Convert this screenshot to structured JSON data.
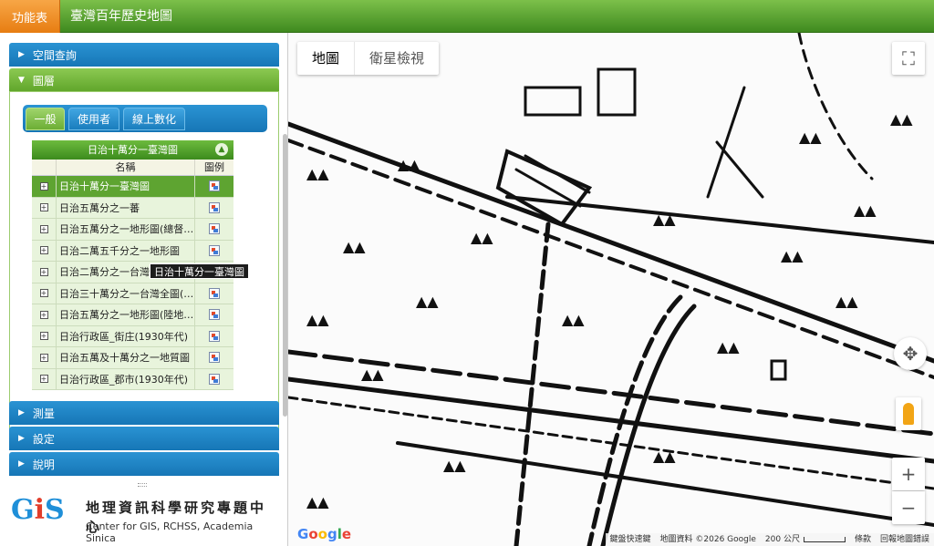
{
  "topbar": {
    "menu_label": "功能表",
    "title": "臺灣百年歷史地圖"
  },
  "sidebar": {
    "sections": {
      "spatial_query": "空間查詢",
      "layers": "圖層",
      "measure": "測量",
      "settings": "設定",
      "help": "說明"
    },
    "tabs": [
      "一般",
      "使用者",
      "線上數化"
    ],
    "active_tab": "一般",
    "layer_table": {
      "title": "日治十萬分一臺灣圖",
      "col_name": "名稱",
      "col_legend": "圖例",
      "rows": [
        "日治十萬分一臺灣圖",
        "日治五萬分之一蕃",
        "日治五萬分之一地形圖(總督…",
        "日治二萬五千分之一地形圖",
        "日治二萬分之一台灣堡圖(大…",
        "日治三十萬分之一台灣全圖(…",
        "日治五萬分之一地形圖(陸地…",
        "日治行政區_街庄(1930年代)",
        "日治五萬及十萬分之一地質圖",
        "日治行政區_郡市(1930年代)"
      ],
      "selected_index": 0
    },
    "tooltip": "日治十萬分一臺灣圖",
    "logo": {
      "mark": "GIS",
      "name_cn": "地理資訊科學研究專題中心",
      "name_en": "Center for GIS, RCHSS, Academia Sinica"
    }
  },
  "map": {
    "type_buttons": [
      "地圖",
      "衛星檢視"
    ],
    "active_type": "地圖",
    "google": "Google",
    "footer": {
      "shortcuts": "鍵盤快速鍵",
      "data": "地圖資料 ©2026 Google",
      "scale": "200 公尺",
      "terms": "條款",
      "report": "回報地圖錯誤"
    },
    "icons": {
      "fullscreen": "fullscreen-icon",
      "pan": "pan-icon",
      "pegman": "pegman-icon",
      "zoom_in": "+",
      "zoom_out": "−"
    }
  }
}
